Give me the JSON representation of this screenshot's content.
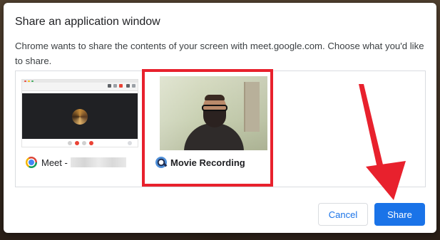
{
  "dialog": {
    "title": "Share an application window",
    "description": "Chrome wants to share the contents of your screen with meet.google.com. Choose what you'd like to share."
  },
  "windows": [
    {
      "icon": "chrome-icon",
      "label": "Meet -",
      "selected": false
    },
    {
      "icon": "quicktime-icon",
      "label": "Movie Recording",
      "selected": true
    }
  ],
  "buttons": {
    "cancel": "Cancel",
    "share": "Share"
  },
  "colors": {
    "accent": "#1a73e8",
    "highlight": "#e8212d"
  }
}
